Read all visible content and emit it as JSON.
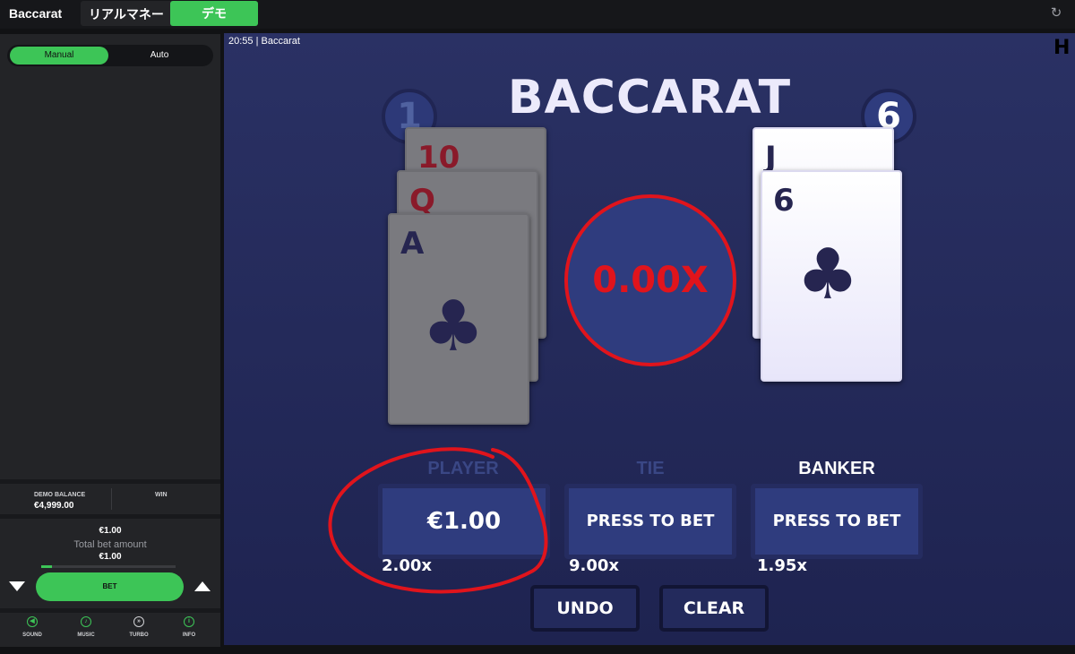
{
  "topbar": {
    "title": "Baccarat",
    "mode_real": "リアルマネー",
    "mode_demo": "デモ",
    "refresh_icon": "refresh-icon"
  },
  "sidebar": {
    "tabs": {
      "manual": "Manual",
      "auto": "Auto",
      "active": "manual"
    },
    "balance": {
      "label": "DEMO BALANCE",
      "value": "€4,999.00",
      "win_label": "WIN"
    },
    "bet": {
      "amount": "€1.00",
      "total_label": "Total bet amount",
      "total_value": "€1.00",
      "bet_button": "BET",
      "slider_level": 0.08
    },
    "footer": [
      {
        "label": "SOUND",
        "icon": "sound-icon"
      },
      {
        "label": "MUSIC",
        "icon": "music-icon"
      },
      {
        "label": "TURBO",
        "icon": "turbo-icon"
      },
      {
        "label": "INFO",
        "icon": "info-icon"
      }
    ]
  },
  "game": {
    "time_label": "20:55  |  Baccarat",
    "title": "BACCARAT",
    "logo": "H",
    "player_score": "1",
    "banker_score": "6",
    "player_cards": [
      {
        "rank": "10",
        "suit": ""
      },
      {
        "rank": "Q",
        "suit": ""
      },
      {
        "rank": "A",
        "suit": "♣"
      }
    ],
    "banker_cards": [
      {
        "rank": "J",
        "suit": ""
      },
      {
        "rank": "6",
        "suit": "♣"
      }
    ],
    "multiplier": "0.00X",
    "bets": {
      "player": {
        "label": "PLAYER",
        "amount": "€1.00",
        "payout": "2.00x"
      },
      "tie": {
        "label": "TIE",
        "amount": "PRESS TO BET",
        "payout": "9.00x"
      },
      "banker": {
        "label": "BANKER",
        "amount": "PRESS TO BET",
        "payout": "1.95x"
      }
    },
    "undo": "UNDO",
    "clear": "CLEAR"
  },
  "colors": {
    "accent": "#3dc557",
    "highlight": "#e0141c",
    "table": "#2a3164"
  }
}
